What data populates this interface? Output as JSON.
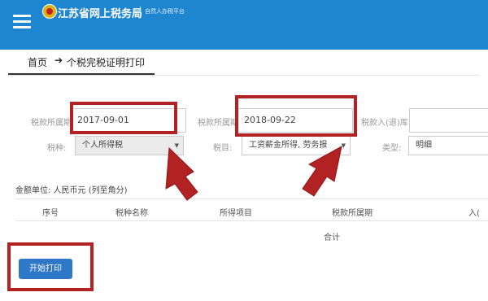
{
  "header": {
    "title": "江苏省网上税务局",
    "subtitle": "自然人办税平台",
    "menu_icon": "hamburger-menu-icon",
    "logo_icon": "tax-emblem-icon",
    "bar_color": "#1e86d0"
  },
  "breadcrumb": {
    "home": "首页",
    "arrow": "➔",
    "current": "个税完税证明打印"
  },
  "form": {
    "period_start_label": "税款所属期",
    "period_start_value": "2017-09-01",
    "period_end_label": "税款所属期",
    "period_end_value": "2018-09-22",
    "refund_label": "税款入(退)库",
    "tax_type_label": "税种:",
    "tax_type_value": "个人所得税",
    "tax_item_label": "税目:",
    "tax_item_value": "工资薪金所得, 劳务报",
    "category_label": "类型:",
    "category_value": "明细"
  },
  "table": {
    "unit_text": "金额单位:  人民币元 (列至角分)",
    "headers": [
      "序号",
      "税种名称",
      "所得项目",
      "税款所属期",
      "入("
    ],
    "total_label": "合计"
  },
  "actions": {
    "print_label": "开始打印"
  },
  "annotations": {
    "highlight_color": "#b22222",
    "arrow_icon": "red-arrow-icon"
  }
}
